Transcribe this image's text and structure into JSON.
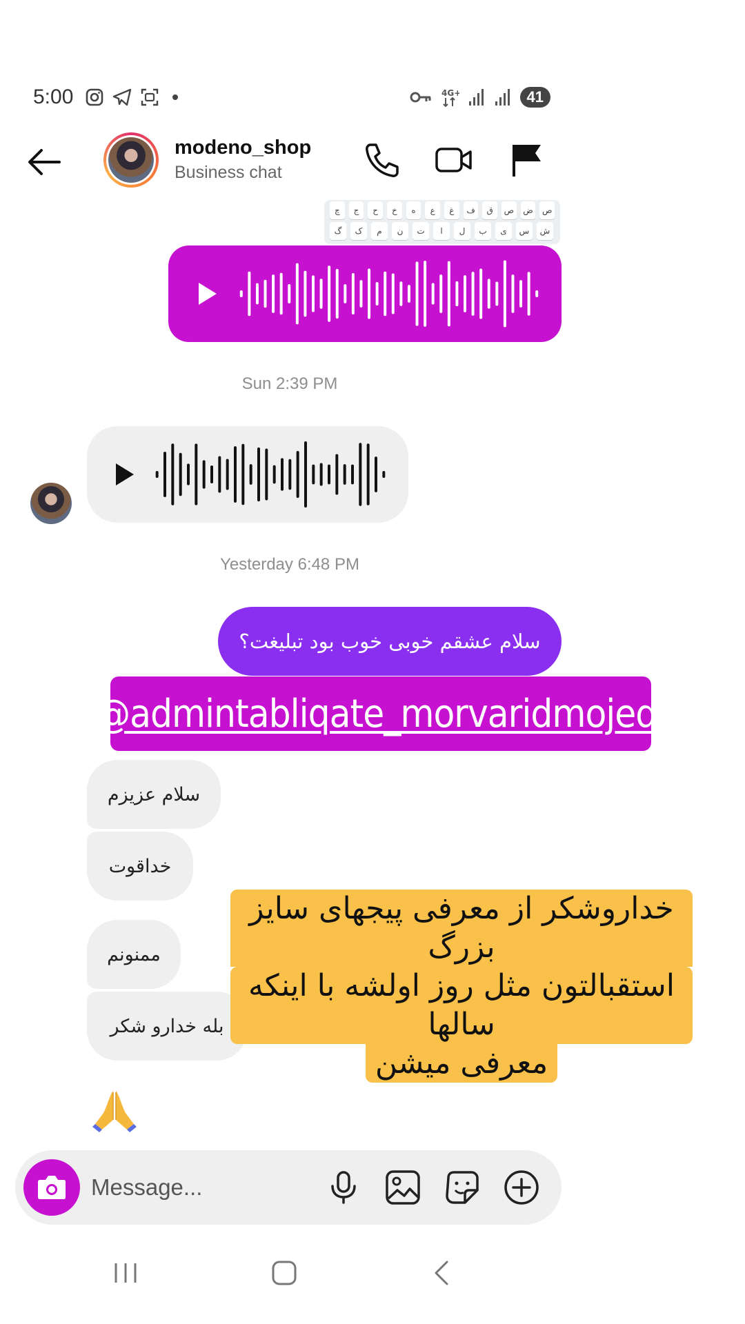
{
  "status_bar": {
    "time": "5:00",
    "network": "4G+",
    "battery": "41",
    "icons_left": [
      "instagram-icon",
      "telegram-icon",
      "screenshot-icon"
    ],
    "icons_right": [
      "vpn-key-icon",
      "signal-icon",
      "signal-icon"
    ]
  },
  "header": {
    "name": "modeno_shop",
    "subtitle": "Business chat",
    "actions": [
      "phone-icon",
      "video-icon",
      "flag-icon"
    ]
  },
  "keyboard_fragment": {
    "row1": [
      "ص",
      "ض",
      "ص",
      "ق",
      "ف",
      "غ",
      "ع",
      "ه",
      "خ",
      "ح",
      "ج",
      "چ"
    ],
    "row2": [
      "ش",
      "س",
      "ی",
      "ب",
      "ل",
      "ا",
      "ت",
      "ن",
      "م",
      "ک",
      "گ"
    ]
  },
  "messages": {
    "time1": "Sun 2:39 PM",
    "time2": "Yesterday 6:48 PM",
    "out_text": "سلام عشقم خوبی خوب بود تبلیغت؟",
    "mention": "@admintabliqate_morvaridmojedi",
    "in1": "سلام عزیزم",
    "in2": "خداقوت",
    "in3": "ممنونم",
    "in4": "بله خدارو شکر",
    "emoji": "🙏"
  },
  "caption": {
    "line1": "خداروشکر از معرفی پیجهای سایز بزرگ",
    "line2": "استقبالتون مثل روز اولشه با اینکه سالها",
    "line3": "معرفی میشن"
  },
  "composer": {
    "placeholder": "Message..."
  },
  "colors": {
    "accent_magenta": "#c711d1",
    "accent_purple": "#8a2ef0",
    "caption_yellow": "#f9c04a",
    "incoming_bubble": "#efefef"
  }
}
